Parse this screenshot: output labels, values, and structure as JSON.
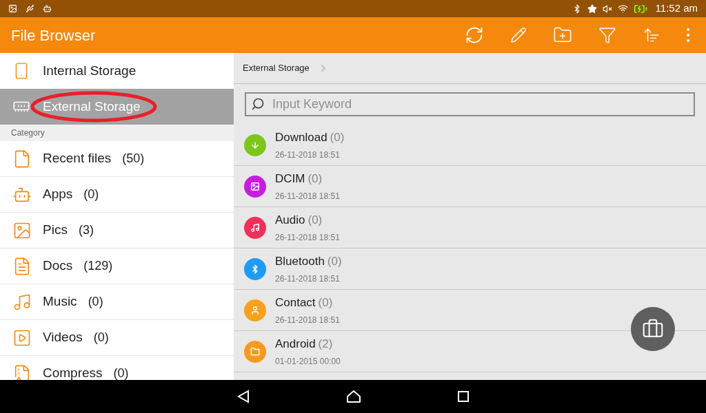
{
  "status_bar": {
    "time": "11:52 am"
  },
  "app_bar": {
    "title": "File Browser"
  },
  "storage": [
    {
      "label": "Internal Storage",
      "kind": "phone",
      "selected": false,
      "circled": false
    },
    {
      "label": "External Storage",
      "kind": "sdcard",
      "selected": true,
      "circled": true
    }
  ],
  "category_header": "Category",
  "categories": [
    {
      "label": "Recent files",
      "count": "(50)",
      "kind": "recent"
    },
    {
      "label": "Apps",
      "count": "(0)",
      "kind": "apps"
    },
    {
      "label": "Pics",
      "count": "(3)",
      "kind": "pics"
    },
    {
      "label": "Docs",
      "count": "(129)",
      "kind": "docs"
    },
    {
      "label": "Music",
      "count": "(0)",
      "kind": "music"
    },
    {
      "label": "Videos",
      "count": "(0)",
      "kind": "videos"
    },
    {
      "label": "Compress",
      "count": "(0)",
      "kind": "compress"
    }
  ],
  "breadcrumb": "External Storage",
  "search": {
    "placeholder": "Input Keyword"
  },
  "folders": [
    {
      "name": "Download",
      "count": "(0)",
      "date": "26-11-2018 18:51",
      "kind": "download",
      "color": "#7cc61e"
    },
    {
      "name": "DCIM",
      "count": "(0)",
      "date": "26-11-2018 18:51",
      "kind": "image",
      "color": "#c61de0"
    },
    {
      "name": "Audio",
      "count": "(0)",
      "date": "26-11-2018 18:51",
      "kind": "music",
      "color": "#f0305a"
    },
    {
      "name": "Bluetooth",
      "count": "(0)",
      "date": "26-11-2018 18:51",
      "kind": "bluetooth",
      "color": "#1f9bf5"
    },
    {
      "name": "Contact",
      "count": "(0)",
      "date": "26-11-2018 18:51",
      "kind": "contact",
      "color": "#f7a11c"
    },
    {
      "name": "Android",
      "count": "(2)",
      "date": "01-01-2015 00:00",
      "kind": "folder",
      "color": "#f79a1c"
    }
  ]
}
